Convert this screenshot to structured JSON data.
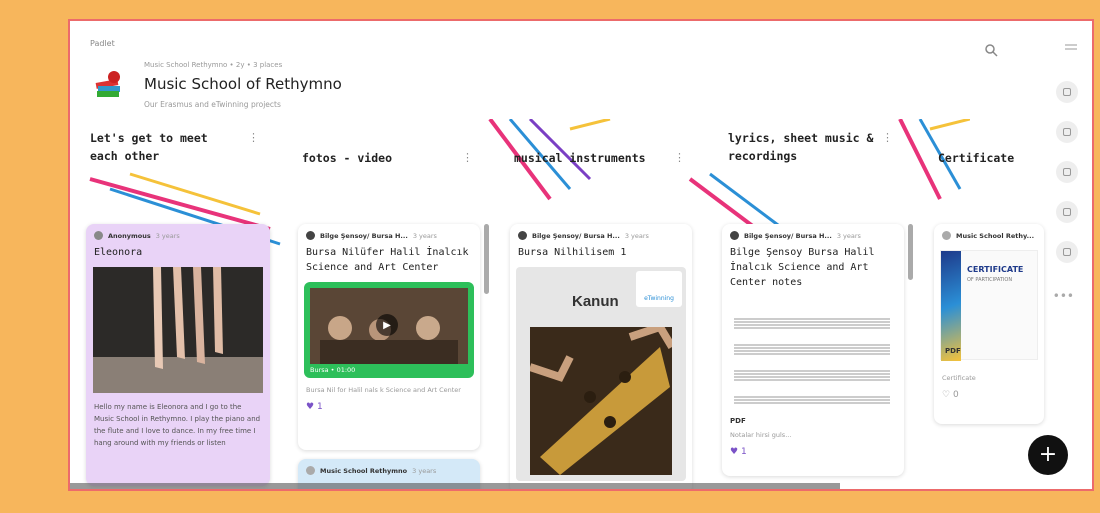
{
  "header": {
    "app_label": "Padlet",
    "meta": "Music School Rethymno • 2y • 3 places",
    "title": "Music School of Rethymno",
    "subtitle": "Our Erasmus and eTwinning projects"
  },
  "columns": [
    {
      "heading": "Let's get to meet each other"
    },
    {
      "heading": "fotos - video"
    },
    {
      "heading": "musical instruments"
    },
    {
      "heading": "lyrics, sheet music & recordings"
    },
    {
      "heading": "Certificate"
    }
  ],
  "cards": {
    "eleonora": {
      "author": "Anonymous",
      "time": "3 years",
      "title": "Eleonora",
      "body": "Hello my name is Eleonora and I go to the Music School in Rethymno. I play the piano and the flute and I love to dance. In my free time I hang around with my friends or listen"
    },
    "bursa_photo": {
      "author": "Bilge Şensoy/ Bursa H...",
      "time": "3 years",
      "title": "Bursa Nilüfer Halil İnalcık Science and Art Center",
      "video_caption": "Bursa • 01:00",
      "desc": "Bursa Nil for Halil nals k Science and Art Center",
      "likes": "1"
    },
    "music_school_card": {
      "author": "Music School Rethymno",
      "time": "3 years"
    },
    "kanun": {
      "author": "Bilge Şensoy/ Bursa H...",
      "time": "3 years",
      "title": "Bursa Nilhilisem 1",
      "label": "Kanun",
      "badge": "eTwinning"
    },
    "notes": {
      "author": "Bilge Şensoy/ Bursa H...",
      "time": "3 years",
      "title": "Bilge Şensoy Bursa Halil İnalcık Science and Art Center notes",
      "file_label": "PDF",
      "caption": "Notalar hirsi guls...",
      "likes": "1"
    },
    "certificate": {
      "author": "Music School Rethy...",
      "title": "CERTIFICATE",
      "sub": "OF PARTICIPATION",
      "file_label": "PDF",
      "caption": "Certificate",
      "likes": "0"
    }
  },
  "fab_label": "+",
  "colors": {
    "frame_bg": "#f7b65c",
    "border": "#ec6b6b",
    "card_purple": "#e9d3f7",
    "card_blue": "#d4e9f8",
    "green": "#2dbf5a"
  }
}
